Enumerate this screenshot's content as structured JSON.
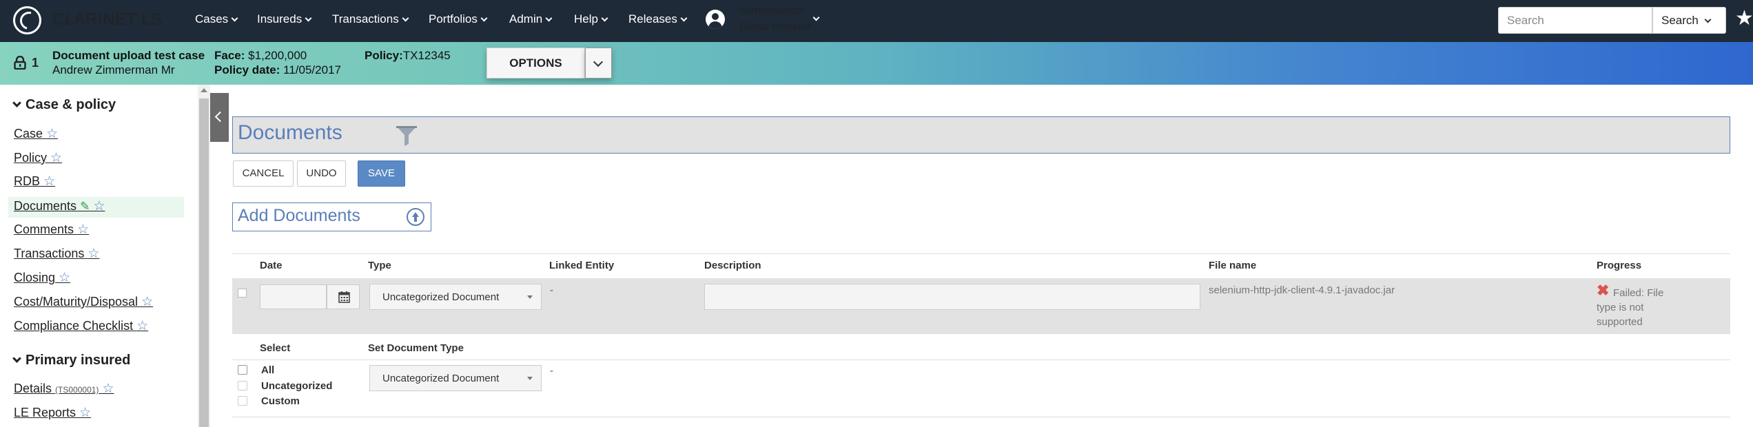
{
  "app": {
    "title": "CLARINET LS"
  },
  "nav": {
    "items": [
      "Cases",
      "Insureds",
      "Transactions",
      "Portfolios",
      "Admin",
      "Help",
      "Releases"
    ],
    "user_login": "demoinvestor",
    "user_name": "Demo Investor",
    "search_placeholder": "Search",
    "search_button": "Search"
  },
  "policy_bar": {
    "lock_count": "1",
    "case_name": "Document upload test case",
    "insured_name": "Andrew Zimmerman Mr",
    "face_label": "Face:",
    "face_value": "$1,200,000",
    "policy_date_label": "Policy date:",
    "policy_date_value": "11/05/2017",
    "policy_label": "Policy:",
    "policy_value": "TX12345",
    "options_label": "OPTIONS"
  },
  "sidebar": {
    "section1": "Case & policy",
    "links1": [
      "Case",
      "Policy",
      "RDB",
      "Documents",
      "Comments",
      "Transactions",
      "Closing",
      "Cost/Maturity/Disposal",
      "Compliance Checklist"
    ],
    "section2": "Primary insured",
    "details_link": "Details",
    "details_id": "(TS000001)",
    "le_link": "LE Reports"
  },
  "main": {
    "title": "Documents",
    "cancel": "CANCEL",
    "undo": "UNDO",
    "save": "SAVE",
    "add_documents": "Add Documents",
    "columns": {
      "date": "Date",
      "type": "Type",
      "linked": "Linked Entity",
      "description": "Description",
      "file_name": "File name",
      "progress": "Progress"
    },
    "row": {
      "type_value": "Uncategorized Document",
      "linked": "-",
      "file_name": "selenium-http-jdk-client-4.9.1-javadoc.jar",
      "progress": "Failed: File type is not supported"
    },
    "select_header": "Select",
    "set_type_header": "Set Document Type",
    "select_options": [
      "All",
      "Uncategorized",
      "Custom"
    ],
    "set_type_value": "Uncategorized Document",
    "set_type_dash": "-"
  },
  "colors": {
    "nav_bg": "#1e2a38",
    "accent": "#5a7fb8",
    "save": "#5a8ac6",
    "fail": "#d9534f"
  }
}
